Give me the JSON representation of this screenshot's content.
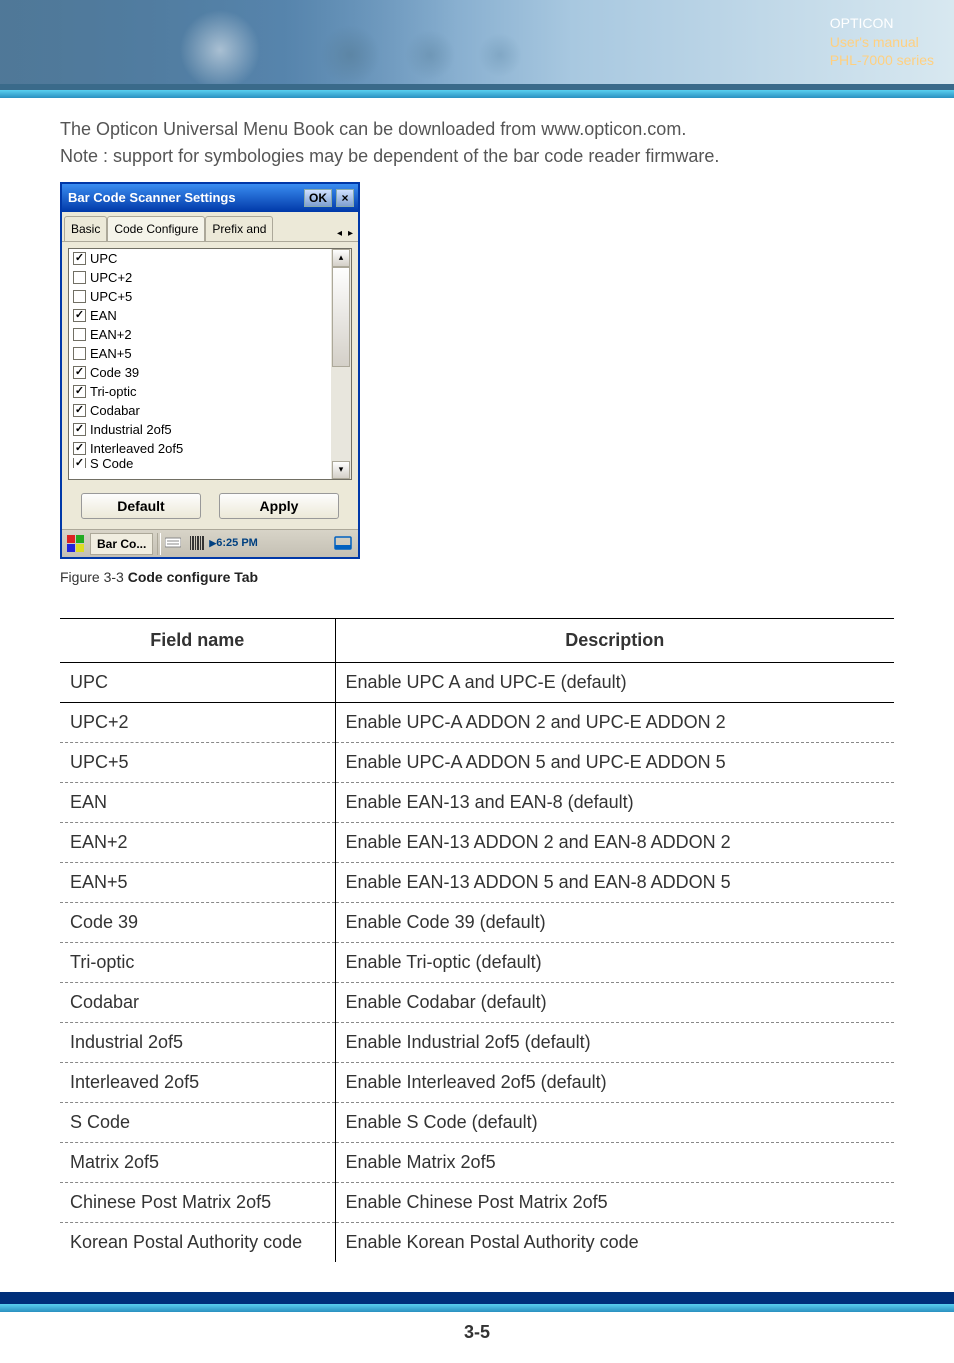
{
  "header": {
    "brand": "OPTICON",
    "line2": "User's manual",
    "line3": "PHL-7000 series"
  },
  "intro": {
    "line1": "The Opticon Universal Menu Book can be downloaded from www.opticon.com.",
    "line2": "Note : support for symbologies may be dependent of the bar code reader firmware."
  },
  "dialog": {
    "title": "Bar Code Scanner Settings",
    "ok": "OK",
    "close": "×",
    "tabs": {
      "basic": "Basic",
      "code_configure": "Code Configure",
      "prefix_and": "Prefix and"
    },
    "items": [
      {
        "label": "UPC",
        "checked": true
      },
      {
        "label": "UPC+2",
        "checked": false
      },
      {
        "label": "UPC+5",
        "checked": false
      },
      {
        "label": "EAN",
        "checked": true
      },
      {
        "label": "EAN+2",
        "checked": false
      },
      {
        "label": "EAN+5",
        "checked": false
      },
      {
        "label": "Code 39",
        "checked": true
      },
      {
        "label": "Tri-optic",
        "checked": true
      },
      {
        "label": "Codabar",
        "checked": true
      },
      {
        "label": "Industrial 2of5",
        "checked": true
      },
      {
        "label": "Interleaved 2of5",
        "checked": true
      },
      {
        "label": "S Code",
        "checked": true,
        "partial": true
      }
    ],
    "buttons": {
      "default": "Default",
      "apply": "Apply"
    },
    "taskbar": {
      "app": "Bar Co...",
      "time": "6:25 PM"
    }
  },
  "caption": {
    "prefix": "Figure 3-3 ",
    "bold": "Code configure Tab"
  },
  "table": {
    "headers": {
      "field": "Field name",
      "desc": "Description"
    },
    "rows": [
      {
        "field": "UPC",
        "desc": "Enable UPC A and UPC-E (default)",
        "border": "solid"
      },
      {
        "field": "UPC+2",
        "desc": "Enable UPC-A ADDON 2 and UPC-E ADDON 2",
        "border": "dash"
      },
      {
        "field": "UPC+5",
        "desc": "Enable UPC-A ADDON 5 and UPC-E ADDON 5",
        "border": "dash"
      },
      {
        "field": "EAN",
        "desc": "Enable EAN-13 and EAN-8 (default)",
        "border": "dash"
      },
      {
        "field": "EAN+2",
        "desc": "Enable EAN-13 ADDON 2 and EAN-8 ADDON 2",
        "border": "dash"
      },
      {
        "field": "EAN+5",
        "desc": "Enable EAN-13 ADDON 5 and EAN-8 ADDON 5",
        "border": "dash"
      },
      {
        "field": "Code 39",
        "desc": "Enable Code 39 (default)",
        "border": "dash"
      },
      {
        "field": "Tri-optic",
        "desc": "Enable Tri-optic (default)",
        "border": "dash"
      },
      {
        "field": "Codabar",
        "desc": "Enable Codabar (default)",
        "border": "dash"
      },
      {
        "field": "Industrial 2of5",
        "desc": "Enable Industrial 2of5 (default)",
        "border": "dash"
      },
      {
        "field": "Interleaved 2of5",
        "desc": "Enable Interleaved 2of5 (default)",
        "border": "dash"
      },
      {
        "field": "S Code",
        "desc": "Enable S Code (default)",
        "border": "dash"
      },
      {
        "field": "Matrix 2of5",
        "desc": "Enable Matrix 2of5",
        "border": "dash"
      },
      {
        "field": "Chinese Post Matrix 2of5",
        "desc": "Enable Chinese Post Matrix 2of5",
        "border": "dash"
      },
      {
        "field": "Korean Postal Authority code",
        "desc": "Enable Korean Postal Authority code",
        "border": "none"
      }
    ]
  },
  "page_number": "3-5"
}
